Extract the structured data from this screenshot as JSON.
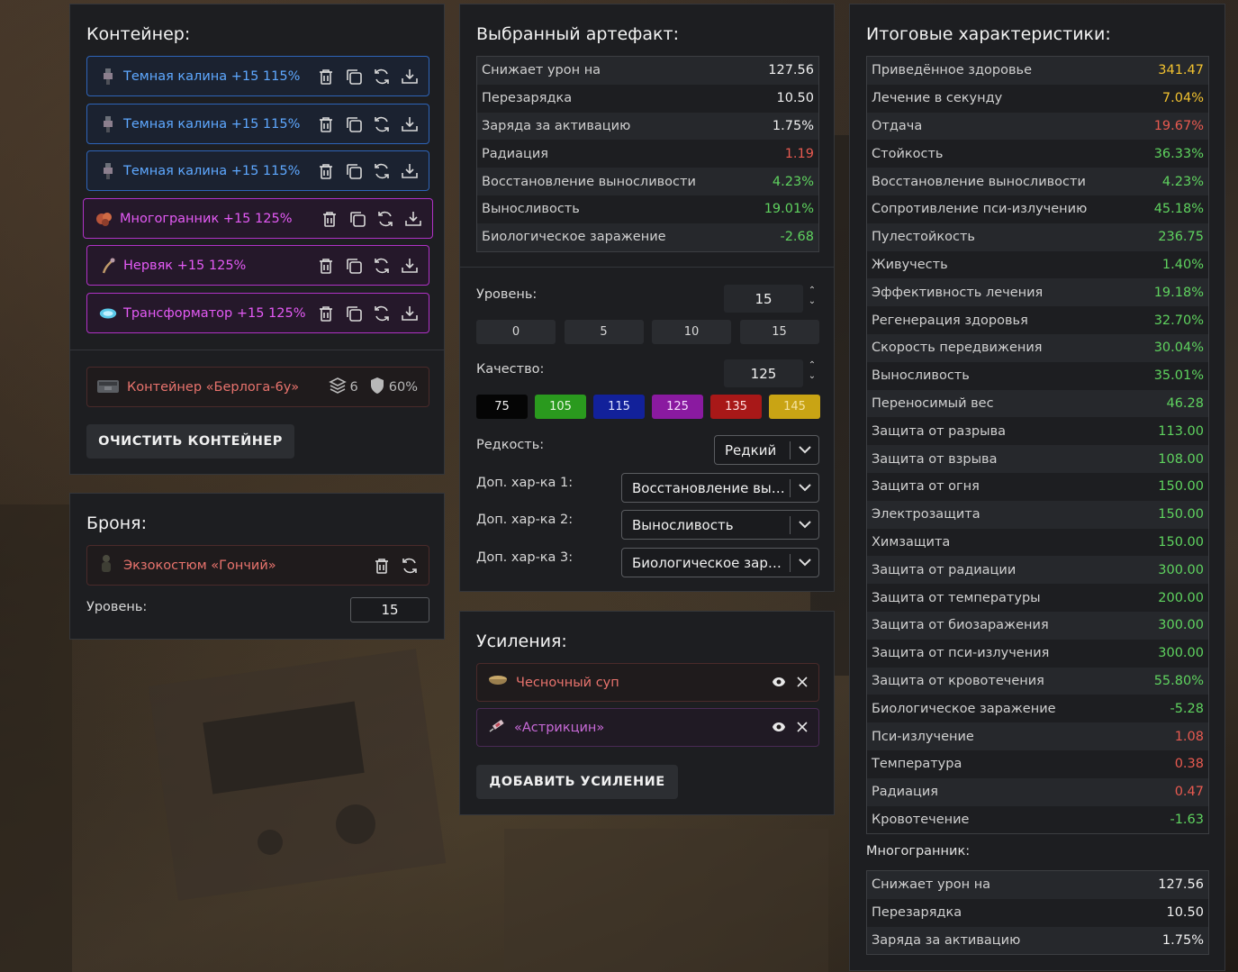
{
  "container": {
    "title": "Контейнер:",
    "artifacts": [
      {
        "name": "Темная калина +15 115%",
        "style": "blue"
      },
      {
        "name": "Темная калина +15 115%",
        "style": "blue"
      },
      {
        "name": "Темная калина +15 115%",
        "style": "blue"
      },
      {
        "name": "Многогранник +15 125%",
        "style": "purple"
      },
      {
        "name": "Нервяк +15 125%",
        "style": "purple"
      },
      {
        "name": "Трансформатор +15 125%",
        "style": "purple"
      }
    ],
    "container_name": "Контейнер «Берлога-6у»",
    "slots": "6",
    "protection": "60%",
    "clear_button": "ОЧИСТИТЬ КОНТЕЙНЕР"
  },
  "armor": {
    "title": "Броня:",
    "name": "Экзокостюм «Гончий»",
    "level_label": "Уровень:",
    "level": "15"
  },
  "selected": {
    "title": "Выбранный артефакт:",
    "stats": [
      {
        "label": "Снижает урон на",
        "value": "127.56",
        "color": "white"
      },
      {
        "label": "Перезарядка",
        "value": "10.50",
        "color": "white"
      },
      {
        "label": "Заряда за активацию",
        "value": "1.75%",
        "color": "white"
      },
      {
        "label": "Радиация",
        "value": "1.19",
        "color": "red"
      },
      {
        "label": "Восстановление выносливости",
        "value": "4.23%",
        "color": "green"
      },
      {
        "label": "Выносливость",
        "value": "19.01%",
        "color": "green"
      },
      {
        "label": "Биологическое заражение",
        "value": "-2.68",
        "color": "green"
      }
    ],
    "level_label": "Уровень:",
    "level": "15",
    "level_presets": [
      "0",
      "5",
      "10",
      "15"
    ],
    "quality_label": "Качество:",
    "quality": "125",
    "quality_presets": [
      {
        "label": "75",
        "bg": "#050505",
        "fg": "#f0f0f0"
      },
      {
        "label": "105",
        "bg": "#2a9a1e",
        "fg": "#e8f8e0"
      },
      {
        "label": "115",
        "bg": "#12219a",
        "fg": "#e0e4ff"
      },
      {
        "label": "125",
        "bg": "#8a1aa0",
        "fg": "#f6dcff"
      },
      {
        "label": "135",
        "bg": "#a81818",
        "fg": "#ffe0e0"
      },
      {
        "label": "145",
        "bg": "#c9a414",
        "fg": "#f5e3a0"
      }
    ],
    "rarity_label": "Редкость:",
    "rarity": "Редкий",
    "extra1_label": "Доп. хар-ка 1:",
    "extra1": "Восстановление выносливости",
    "extra2_label": "Доп. хар-ка 2:",
    "extra2": "Выносливость",
    "extra3_label": "Доп. хар-ка 3:",
    "extra3": "Биологическое заражение"
  },
  "boosts": {
    "title": "Усиления:",
    "items": [
      {
        "name": "Чесночный суп",
        "style": "red"
      },
      {
        "name": "«Астрикцин»",
        "style": "purple"
      }
    ],
    "add_button": "ДОБАВИТЬ УСИЛЕНИЕ"
  },
  "totals": {
    "title": "Итоговые характеристики:",
    "stats": [
      {
        "label": "Приведённое здоровье",
        "value": "341.47",
        "color": "yellow"
      },
      {
        "label": "Лечение в секунду",
        "value": "7.04%",
        "color": "yellow"
      },
      {
        "label": "Отдача",
        "value": "19.67%",
        "color": "red"
      },
      {
        "label": "Стойкость",
        "value": "36.33%",
        "color": "green"
      },
      {
        "label": "Восстановление выносливости",
        "value": "4.23%",
        "color": "green"
      },
      {
        "label": "Сопротивление пси-излучению",
        "value": "45.18%",
        "color": "green"
      },
      {
        "label": "Пулестойкость",
        "value": "236.75",
        "color": "green"
      },
      {
        "label": "Живучесть",
        "value": "1.40%",
        "color": "green"
      },
      {
        "label": "Эффективность лечения",
        "value": "19.18%",
        "color": "green"
      },
      {
        "label": "Регенерация здоровья",
        "value": "32.70%",
        "color": "green"
      },
      {
        "label": "Скорость передвижения",
        "value": "30.04%",
        "color": "green"
      },
      {
        "label": "Выносливость",
        "value": "35.01%",
        "color": "green"
      },
      {
        "label": "Переносимый вес",
        "value": "46.28",
        "color": "green"
      },
      {
        "label": "Защита от разрыва",
        "value": "113.00",
        "color": "green"
      },
      {
        "label": "Защита от взрыва",
        "value": "108.00",
        "color": "green"
      },
      {
        "label": "Защита от огня",
        "value": "150.00",
        "color": "green"
      },
      {
        "label": "Электрозащита",
        "value": "150.00",
        "color": "green"
      },
      {
        "label": "Химзащита",
        "value": "150.00",
        "color": "green"
      },
      {
        "label": "Защита от радиации",
        "value": "300.00",
        "color": "green"
      },
      {
        "label": "Защита от температуры",
        "value": "200.00",
        "color": "green"
      },
      {
        "label": "Защита от биозаражения",
        "value": "300.00",
        "color": "green"
      },
      {
        "label": "Защита от пси-излучения",
        "value": "300.00",
        "color": "green"
      },
      {
        "label": "Защита от кровотечения",
        "value": "55.80%",
        "color": "green"
      },
      {
        "label": "Биологическое заражение",
        "value": "-5.28",
        "color": "green"
      },
      {
        "label": "Пси-излучение",
        "value": "1.08",
        "color": "red"
      },
      {
        "label": "Температура",
        "value": "0.38",
        "color": "red"
      },
      {
        "label": "Радиация",
        "value": "0.47",
        "color": "red"
      },
      {
        "label": "Кровотечение",
        "value": "-1.63",
        "color": "green"
      }
    ],
    "sub_title": "Многогранник:",
    "sub_stats": [
      {
        "label": "Снижает урон на",
        "value": "127.56",
        "color": "white"
      },
      {
        "label": "Перезарядка",
        "value": "10.50",
        "color": "white"
      },
      {
        "label": "Заряда за активацию",
        "value": "1.75%",
        "color": "white"
      }
    ]
  }
}
